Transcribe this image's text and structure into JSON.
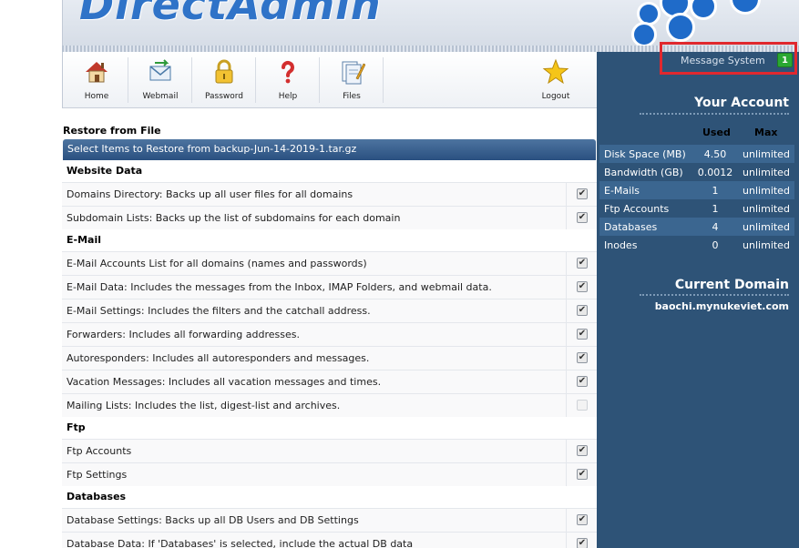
{
  "brand": {
    "logo_text": "DirectAdmin"
  },
  "toolbar": [
    {
      "label": "Home",
      "icon": "home-icon"
    },
    {
      "label": "Webmail",
      "icon": "webmail-icon"
    },
    {
      "label": "Password",
      "icon": "lock-icon"
    },
    {
      "label": "Help",
      "icon": "help-icon"
    },
    {
      "label": "Files",
      "icon": "files-icon"
    },
    {
      "label": "Logout",
      "icon": "star-icon"
    }
  ],
  "messages": {
    "label": "Message System",
    "count": "1",
    "highlight_color": "#e0282e"
  },
  "account": {
    "title": "Your Account",
    "col_used": "Used",
    "col_max": "Max",
    "rows": [
      {
        "name": "Disk Space (MB)",
        "used": "4.50",
        "max": "unlimited"
      },
      {
        "name": "Bandwidth (GB)",
        "used": "0.0012",
        "max": "unlimited"
      },
      {
        "name": "E-Mails",
        "used": "1",
        "max": "unlimited"
      },
      {
        "name": "Ftp Accounts",
        "used": "1",
        "max": "unlimited"
      },
      {
        "name": "Databases",
        "used": "4",
        "max": "unlimited"
      },
      {
        "name": "Inodes",
        "used": "0",
        "max": "unlimited"
      }
    ]
  },
  "current_domain": {
    "title": "Current Domain",
    "value": "baochi.mynukeviet.com"
  },
  "restore": {
    "title": "Restore from File",
    "select_label": "Select Items to Restore from backup-Jun-14-2019-1.tar.gz",
    "sections": [
      {
        "name": "Website Data",
        "items": [
          {
            "label": "Domains Directory: Backs up all user files for all domains",
            "checked": true
          },
          {
            "label": "Subdomain Lists: Backs up the list of subdomains for each domain",
            "checked": true
          }
        ]
      },
      {
        "name": "E-Mail",
        "items": [
          {
            "label": "E-Mail Accounts List for all domains (names and passwords)",
            "checked": true
          },
          {
            "label": "E-Mail Data: Includes the messages from the Inbox, IMAP Folders, and webmail data.",
            "checked": true
          },
          {
            "label": "E-Mail Settings: Includes the filters and the catchall address.",
            "checked": true
          },
          {
            "label": "Forwarders: Includes all forwarding addresses.",
            "checked": true
          },
          {
            "label": "Autoresponders: Includes all autoresponders and messages.",
            "checked": true
          },
          {
            "label": "Vacation Messages: Includes all vacation messages and times.",
            "checked": true
          },
          {
            "label": "Mailing Lists: Includes the list, digest-list and archives.",
            "checked": false
          }
        ]
      },
      {
        "name": "Ftp",
        "items": [
          {
            "label": "Ftp Accounts",
            "checked": true
          },
          {
            "label": "Ftp Settings",
            "checked": true
          }
        ]
      },
      {
        "name": "Databases",
        "items": [
          {
            "label": "Database Settings: Backs up all DB Users and DB Settings",
            "checked": true
          },
          {
            "label": "Database Data: If 'Databases' is selected, include the actual DB data",
            "checked": true
          }
        ]
      }
    ]
  }
}
